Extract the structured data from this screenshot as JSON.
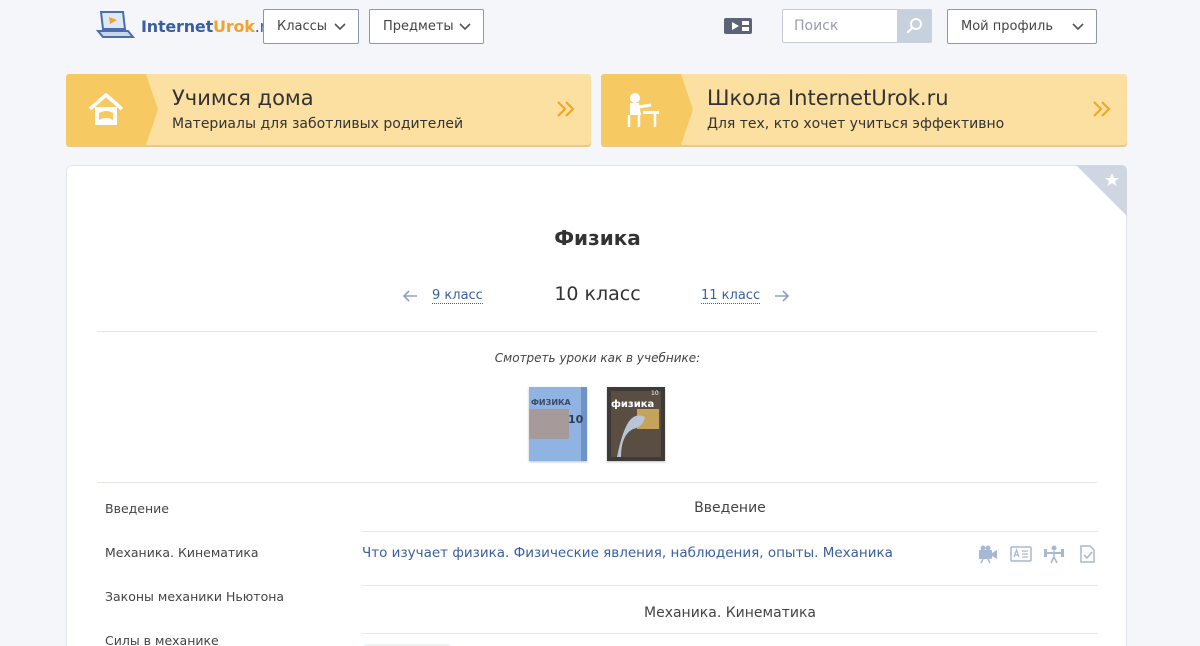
{
  "header": {
    "logo": {
      "part1": "Internet",
      "part2": "Urok",
      "part3": ".ru"
    },
    "classes_label": "Классы",
    "subjects_label": "Предметы",
    "search_placeholder": "Поиск",
    "profile_label": "Мой профиль"
  },
  "banners": [
    {
      "title": "Учимся дома",
      "subtitle": "Материалы для заботливых родителей",
      "icon": "house-icon"
    },
    {
      "title": "Школа InternetUrok.ru",
      "subtitle": "Для тех, кто хочет учиться эффективно",
      "icon": "student-desk-icon"
    }
  ],
  "subject": {
    "title": "Физика",
    "current_grade": "10 класс",
    "prev_grade": "9 класс",
    "next_grade": "11 класс"
  },
  "textbooks": {
    "caption": "Смотреть уроки как в учебнике:",
    "books": [
      {
        "cover_text": "ФИЗИКА",
        "number": "10",
        "color": "#8fb3e3"
      },
      {
        "cover_text": "физика",
        "number": "10",
        "color": "#3d3a38"
      }
    ]
  },
  "sidebar": {
    "items": [
      {
        "label": "Введение"
      },
      {
        "label": "Механика. Кинематика"
      },
      {
        "label": "Законы механики Ньютона"
      },
      {
        "label": "Силы в механике"
      }
    ]
  },
  "lessons": {
    "topics": [
      {
        "title": "Введение",
        "rows": [
          {
            "title": "Что изучает физика. Физические явления, наблюдения, опыты. Механика"
          }
        ]
      },
      {
        "title": "Механика. Кинематика"
      }
    ]
  },
  "colors": {
    "link": "#3a5ea0",
    "banner_bg": "#fbe0a2",
    "banner_icon_bg": "#f7c963",
    "accent_orange": "#f3a32b"
  }
}
